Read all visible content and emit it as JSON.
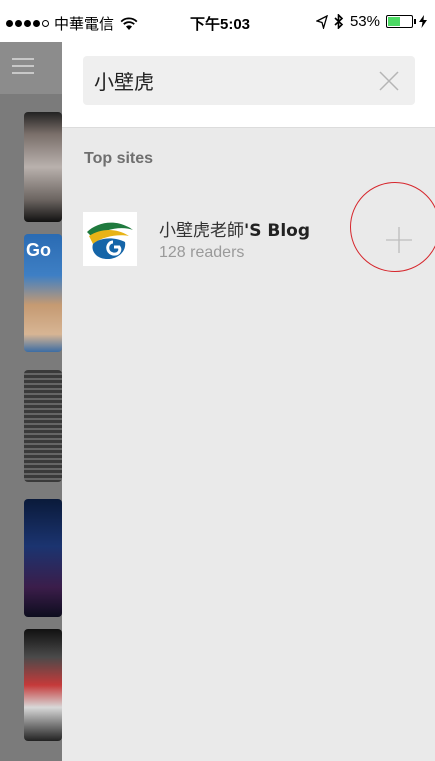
{
  "status_bar": {
    "carrier": "中華電信",
    "time": "下午5:03",
    "battery_text": "53%",
    "battery_level": 0.53,
    "signal_bars_filled": 4,
    "signal_bars_total": 5
  },
  "search": {
    "query": "小壁虎",
    "clear_icon": "close-icon"
  },
  "top_sites": {
    "title": "Top sites",
    "items": [
      {
        "name_regular": "小壁虎老師",
        "name_bold": "'S Blog",
        "readers": "128 readers",
        "add_icon": "plus-icon"
      }
    ]
  },
  "background": {
    "thumb2_label": "Go"
  },
  "colors": {
    "panel_bg": "#eaeaea",
    "annotation_circle": "#d6262c",
    "battery_fill": "#4cd964"
  }
}
